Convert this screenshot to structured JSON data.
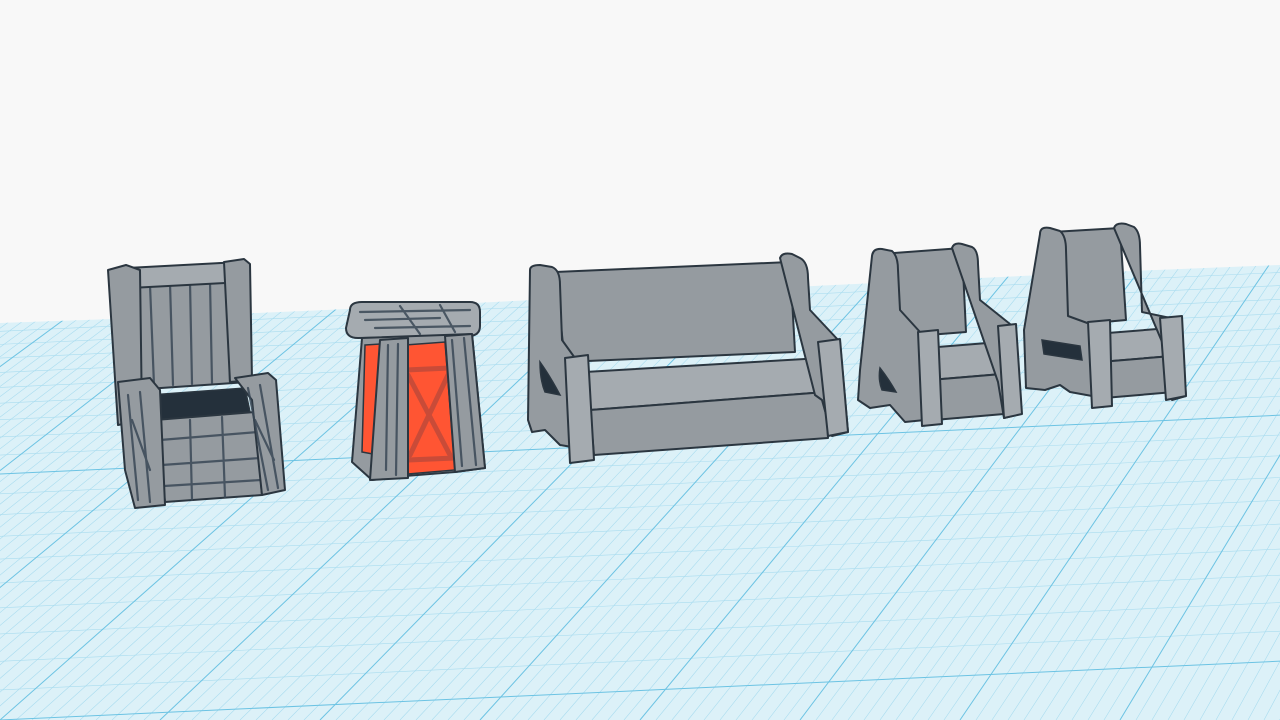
{
  "scene": {
    "background_color": "#f8f8f8",
    "workplane": {
      "fill_color": "#dcf1f8",
      "minor_line_color": "#a9dcef",
      "major_line_color": "#6cc3e3"
    },
    "model_colors": {
      "body": "#959ba0",
      "light": "#a5abb0",
      "shadow": "#6f777e",
      "edge": "#2b3640",
      "wood_grain": "#3a4856",
      "hole": "#24303b",
      "accent": "#ff5533"
    },
    "models": [
      {
        "id": "rustic-throne-chair",
        "icon": "throne-chair-icon"
      },
      {
        "id": "rustic-side-table",
        "icon": "side-table-icon"
      },
      {
        "id": "sofa",
        "icon": "sofa-icon"
      },
      {
        "id": "armchair",
        "icon": "armchair-icon"
      },
      {
        "id": "high-back-chair",
        "icon": "high-back-chair-icon"
      }
    ]
  }
}
